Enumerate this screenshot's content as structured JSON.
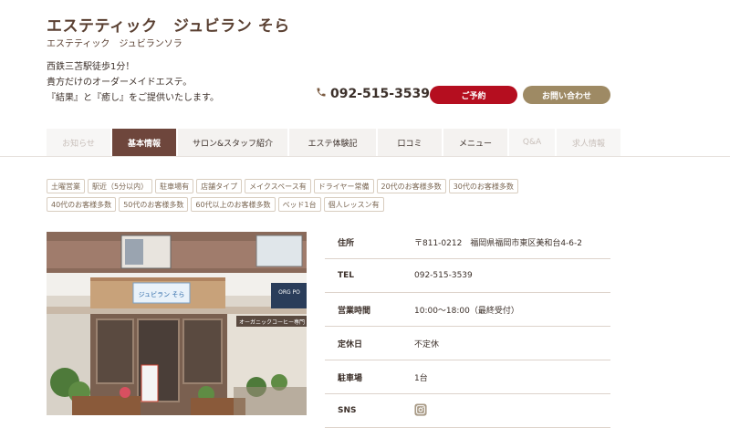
{
  "header": {
    "title": "エステティック　ジュビラン そら",
    "subtitle": "エステティック　ジュビランソラ",
    "description": [
      "西鉄三苫駅徒歩1分！",
      "貴方だけのオーダーメイドエステ。",
      "『結果』と『癒し』をご提供いたします。"
    ],
    "phone": "092-515-3539",
    "phone_icon": "phone-icon",
    "reserve_label": "ご予約",
    "inquiry_label": "お問い合わせ"
  },
  "nav": {
    "tabs": [
      {
        "label": "お知らせ",
        "state": "disabled"
      },
      {
        "label": "基本情報",
        "state": "active"
      },
      {
        "label": "サロン&スタッフ紹介",
        "state": "normal"
      },
      {
        "label": "エステ体験記",
        "state": "normal"
      },
      {
        "label": "口コミ",
        "state": "normal"
      },
      {
        "label": "メニュー",
        "state": "normal"
      },
      {
        "label": "Q&A",
        "state": "disabled"
      },
      {
        "label": "求人情報",
        "state": "disabled"
      }
    ]
  },
  "tags": [
    "土曜営業",
    "駅近（5分以内）",
    "駐車場有",
    "店舗タイプ",
    "メイクスペース有",
    "ドライヤー常備",
    "20代のお客様多数",
    "30代のお客様多数",
    "40代のお客様多数",
    "50代のお客様多数",
    "60代以上のお客様多数",
    "ベッド1台",
    "個人レッスン有"
  ],
  "storefront": {
    "sign_text": "ジュビラン そら",
    "shop_sign": "ORG PO",
    "coffee_sign": "オーガニックコーヒー専門"
  },
  "info": [
    {
      "label": "住所",
      "value": "〒811-0212　福岡県福岡市東区美和台4-6-2"
    },
    {
      "label": "TEL",
      "value": "092-515-3539"
    },
    {
      "label": "営業時間",
      "value": "10:00〜18:00（最終受付）"
    },
    {
      "label": "定休日",
      "value": "不定休"
    },
    {
      "label": "駐車場",
      "value": "1台"
    },
    {
      "label": "SNS",
      "value": ""
    }
  ],
  "colors": {
    "accent": "#6e463c",
    "reserve": "#b50e1f",
    "inquiry": "#9e8a64"
  }
}
